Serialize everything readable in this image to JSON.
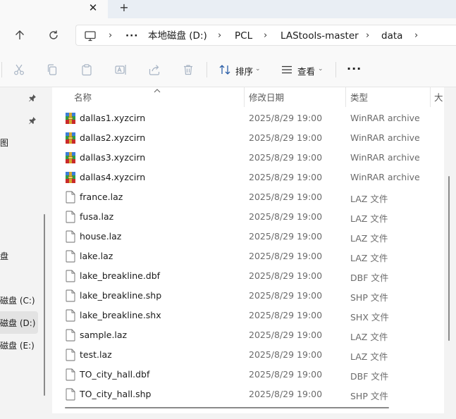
{
  "breadcrumb": {
    "more": "···",
    "items": [
      "本地磁盘 (D:)",
      "PCL",
      "LAStools-master",
      "data"
    ]
  },
  "toolbar": {
    "sort_label": "排序",
    "view_label": "查看",
    "more": "···"
  },
  "nav": {
    "item_partial_1": "图",
    "item_partial_2": "盘",
    "drive_c": "磁盘 (C:)",
    "drive_d": "磁盘 (D:)",
    "drive_e": "磁盘 (E:)"
  },
  "columns": {
    "name": "名称",
    "date": "修改日期",
    "type": "类型",
    "size": "大"
  },
  "files": [
    {
      "name": "dallas1.xyzcirn",
      "date": "2025/8/29 19:00",
      "type": "WinRAR archive",
      "icon": "winrar-icon"
    },
    {
      "name": "dallas2.xyzcirn",
      "date": "2025/8/29 19:00",
      "type": "WinRAR archive",
      "icon": "winrar-icon"
    },
    {
      "name": "dallas3.xyzcirn",
      "date": "2025/8/29 19:00",
      "type": "WinRAR archive",
      "icon": "winrar-icon"
    },
    {
      "name": "dallas4.xyzcirn",
      "date": "2025/8/29 19:00",
      "type": "WinRAR archive",
      "icon": "winrar-icon"
    },
    {
      "name": "france.laz",
      "date": "2025/8/29 19:00",
      "type": "LAZ 文件",
      "icon": "file-icon"
    },
    {
      "name": "fusa.laz",
      "date": "2025/8/29 19:00",
      "type": "LAZ 文件",
      "icon": "file-icon"
    },
    {
      "name": "house.laz",
      "date": "2025/8/29 19:00",
      "type": "LAZ 文件",
      "icon": "file-icon"
    },
    {
      "name": "lake.laz",
      "date": "2025/8/29 19:00",
      "type": "LAZ 文件",
      "icon": "file-icon"
    },
    {
      "name": "lake_breakline.dbf",
      "date": "2025/8/29 19:00",
      "type": "DBF 文件",
      "icon": "file-icon"
    },
    {
      "name": "lake_breakline.shp",
      "date": "2025/8/29 19:00",
      "type": "SHP 文件",
      "icon": "file-icon"
    },
    {
      "name": "lake_breakline.shx",
      "date": "2025/8/29 19:00",
      "type": "SHX 文件",
      "icon": "file-icon"
    },
    {
      "name": "sample.laz",
      "date": "2025/8/29 19:00",
      "type": "LAZ 文件",
      "icon": "file-icon"
    },
    {
      "name": "test.laz",
      "date": "2025/8/29 19:00",
      "type": "LAZ 文件",
      "icon": "file-icon"
    },
    {
      "name": "TO_city_hall.dbf",
      "date": "2025/8/29 19:00",
      "type": "DBF 文件",
      "icon": "file-icon"
    },
    {
      "name": "TO_city_hall.shp",
      "date": "2025/8/29 19:00",
      "type": "SHP 文件",
      "icon": "file-icon"
    }
  ]
}
